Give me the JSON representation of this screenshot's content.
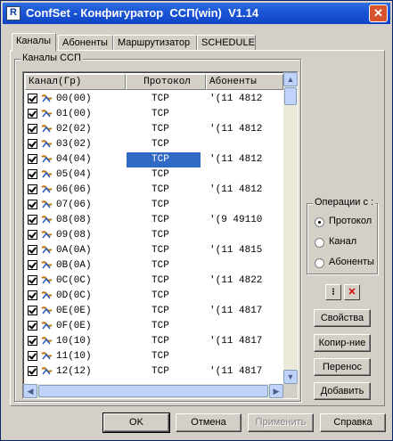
{
  "window": {
    "title": "ConfSet - Конфигуратор  ССП(win)  V1.14",
    "close_label": "✕"
  },
  "tabs": [
    {
      "label": "Каналы",
      "active": true
    },
    {
      "label": "Абоненты",
      "active": false
    },
    {
      "label": "Маршрутизатор",
      "active": false
    },
    {
      "label": "SCHEDULE",
      "active": false
    }
  ],
  "channels_group": {
    "legend": "Каналы  ССП"
  },
  "columns": [
    "Канал(Гр)",
    "Протокол",
    "Абоненты"
  ],
  "rows": [
    {
      "channel": "00(00)",
      "protocol": "TCP",
      "subscribers": "'(11 4812"
    },
    {
      "channel": "01(00)",
      "protocol": "TCP",
      "subscribers": ""
    },
    {
      "channel": "02(02)",
      "protocol": "TCP",
      "subscribers": "'(11 4812"
    },
    {
      "channel": "03(02)",
      "protocol": "TCP",
      "subscribers": ""
    },
    {
      "channel": "04(04)",
      "protocol": "TCP",
      "subscribers": "'(11 4812",
      "selected": true
    },
    {
      "channel": "05(04)",
      "protocol": "TCP",
      "subscribers": ""
    },
    {
      "channel": "06(06)",
      "protocol": "TCP",
      "subscribers": "'(11 4812"
    },
    {
      "channel": "07(06)",
      "protocol": "TCP",
      "subscribers": ""
    },
    {
      "channel": "08(08)",
      "protocol": "TCP",
      "subscribers": "'(9 49110"
    },
    {
      "channel": "09(08)",
      "protocol": "TCP",
      "subscribers": ""
    },
    {
      "channel": "0A(0A)",
      "protocol": "TCP",
      "subscribers": "'(11 4815"
    },
    {
      "channel": "0B(0A)",
      "protocol": "TCP",
      "subscribers": ""
    },
    {
      "channel": "0C(0C)",
      "protocol": "TCP",
      "subscribers": "'(11 4822"
    },
    {
      "channel": "0D(0C)",
      "protocol": "TCP",
      "subscribers": ""
    },
    {
      "channel": "0E(0E)",
      "protocol": "TCP",
      "subscribers": "'(11 4817"
    },
    {
      "channel": "0F(0E)",
      "protocol": "TCP",
      "subscribers": ""
    },
    {
      "channel": "10(10)",
      "protocol": "TCP",
      "subscribers": "'(11 4817"
    },
    {
      "channel": "11(10)",
      "protocol": "TCP",
      "subscribers": ""
    },
    {
      "channel": "12(12)",
      "protocol": "TCP",
      "subscribers": "'(11 4817"
    }
  ],
  "operations": {
    "legend": "Операции с :",
    "options": [
      {
        "label": "Протокол",
        "checked": true
      },
      {
        "label": "Канал",
        "checked": false
      },
      {
        "label": "Абоненты",
        "checked": false
      }
    ]
  },
  "side_buttons": {
    "properties": "Свойства",
    "copy": "Копир-ние",
    "move": "Перенос",
    "add": "Добавить"
  },
  "bottom_buttons": {
    "ok": "OK",
    "cancel": "Отмена",
    "apply": "Применить",
    "help": "Справка"
  },
  "colors": {
    "title_bar": "#1c56d6",
    "selection": "#316ac5",
    "face": "#d4d0c8"
  }
}
